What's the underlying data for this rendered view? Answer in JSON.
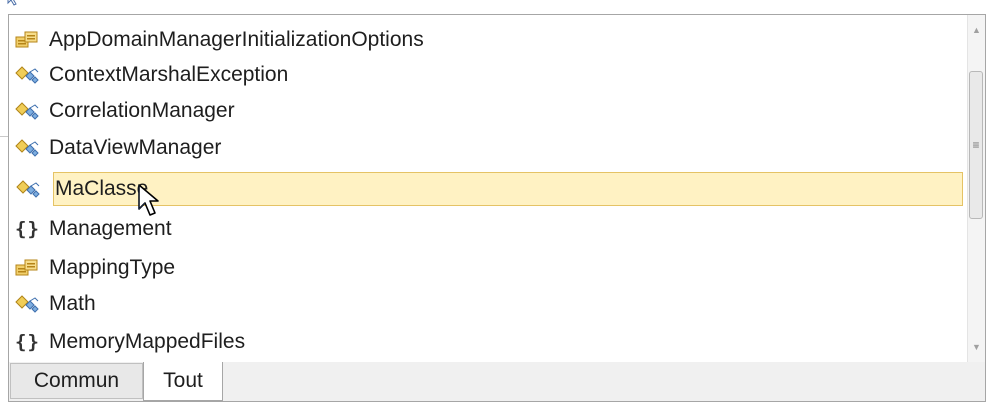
{
  "intellisense": {
    "items": [
      {
        "label": "AppDomainManagerInitializationOptions",
        "icon": "enum-icon"
      },
      {
        "label": "ContextMarshalException",
        "icon": "class-icon"
      },
      {
        "label": "CorrelationManager",
        "icon": "class-icon"
      },
      {
        "label": "DataViewManager",
        "icon": "class-icon"
      },
      {
        "label": "MaClasse",
        "icon": "class-icon"
      },
      {
        "label": "Management",
        "icon": "namespace-icon"
      },
      {
        "label": "MappingType",
        "icon": "enum-icon"
      },
      {
        "label": "Math",
        "icon": "class-icon"
      },
      {
        "label": "MemoryMappedFiles",
        "icon": "namespace-icon"
      }
    ],
    "selected_index": 4,
    "namespace_glyph": "{}",
    "scrollbar_grip": "≡",
    "scroll_up": "▲",
    "scroll_down": "▼"
  },
  "tabs": {
    "common_label": "Commun",
    "all_label": "Tout",
    "active": "Tout"
  },
  "colors": {
    "selection_bg": "#fff2c3",
    "selection_border": "#e5c365",
    "enum_icon": "#d8a332",
    "class_icon_left": "#e8c75a",
    "class_icon_right": "#4f84c4"
  }
}
